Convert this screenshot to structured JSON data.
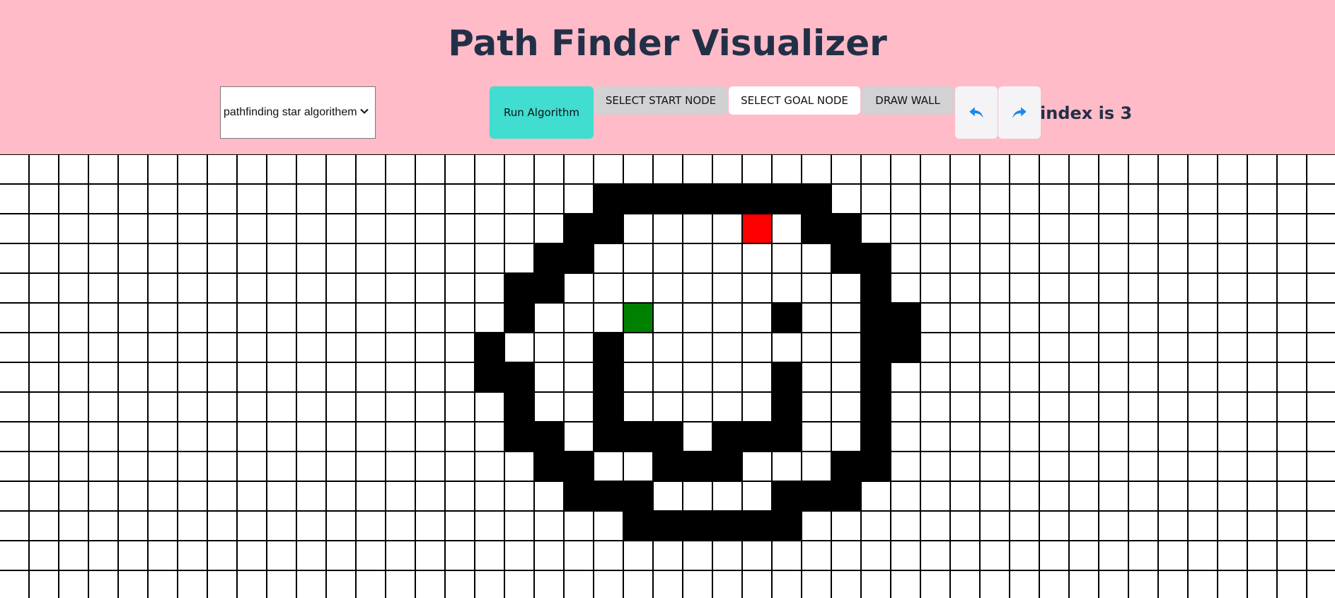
{
  "title": "Path Finder Visualizer",
  "controls": {
    "algorithm_select": {
      "value": "pathfinding star algorithem"
    },
    "run_label": "Run Algorithm",
    "start_label": "SELECT START NODE",
    "goal_label": "SELECT GOAL NODE",
    "wall_label": "DRAW WALL",
    "undo_icon": "undo-icon",
    "redo_icon": "redo-icon",
    "index_text": "index is 3"
  },
  "colors": {
    "header_bg": "#ffbbc8",
    "title": "#223047",
    "run_button": "#40ddd0",
    "wall": "#000000",
    "start_node": "#008000",
    "goal_node": "#ff0000",
    "icon": "#1e88e5"
  },
  "grid": {
    "columns": 46,
    "rows": 15,
    "walls": [
      [
        1,
        20
      ],
      [
        1,
        21
      ],
      [
        1,
        22
      ],
      [
        1,
        23
      ],
      [
        1,
        24
      ],
      [
        1,
        25
      ],
      [
        1,
        26
      ],
      [
        1,
        27
      ],
      [
        2,
        19
      ],
      [
        2,
        20
      ],
      [
        2,
        27
      ],
      [
        2,
        28
      ],
      [
        3,
        18
      ],
      [
        3,
        19
      ],
      [
        3,
        28
      ],
      [
        3,
        29
      ],
      [
        4,
        17
      ],
      [
        4,
        18
      ],
      [
        4,
        29
      ],
      [
        5,
        17
      ],
      [
        5,
        26
      ],
      [
        5,
        29
      ],
      [
        5,
        30
      ],
      [
        6,
        16
      ],
      [
        6,
        20
      ],
      [
        6,
        29
      ],
      [
        6,
        30
      ],
      [
        7,
        16
      ],
      [
        7,
        17
      ],
      [
        7,
        20
      ],
      [
        7,
        26
      ],
      [
        7,
        29
      ],
      [
        8,
        17
      ],
      [
        8,
        20
      ],
      [
        8,
        26
      ],
      [
        8,
        29
      ],
      [
        9,
        17
      ],
      [
        9,
        18
      ],
      [
        9,
        20
      ],
      [
        9,
        21
      ],
      [
        9,
        22
      ],
      [
        9,
        24
      ],
      [
        9,
        25
      ],
      [
        9,
        26
      ],
      [
        9,
        29
      ],
      [
        10,
        18
      ],
      [
        10,
        19
      ],
      [
        10,
        22
      ],
      [
        10,
        23
      ],
      [
        10,
        24
      ],
      [
        10,
        28
      ],
      [
        10,
        29
      ],
      [
        11,
        19
      ],
      [
        11,
        20
      ],
      [
        11,
        21
      ],
      [
        11,
        26
      ],
      [
        11,
        27
      ],
      [
        11,
        28
      ],
      [
        12,
        21
      ],
      [
        12,
        22
      ],
      [
        12,
        23
      ],
      [
        12,
        24
      ],
      [
        12,
        25
      ],
      [
        12,
        26
      ]
    ],
    "start_node": [
      5,
      21
    ],
    "goal_node": [
      2,
      25
    ]
  }
}
